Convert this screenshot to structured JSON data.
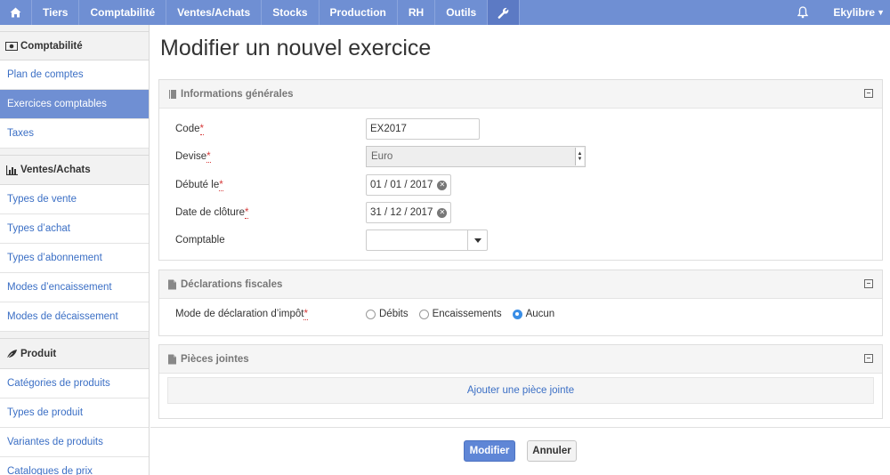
{
  "topnav": {
    "home_icon": "home-icon",
    "items": [
      "Tiers",
      "Comptabilité",
      "Ventes/Achats",
      "Stocks",
      "Production",
      "RH",
      "Outils"
    ],
    "tools_icon": "wrench-icon",
    "bell_icon": "bell-icon",
    "user": "Ekylibre",
    "accent": "#6f8fd3"
  },
  "sidebar": {
    "sections": [
      {
        "title": "Comptabilité",
        "icon": "money-icon",
        "items": [
          "Plan de comptes",
          "Exercices comptables",
          "Taxes"
        ],
        "active": "Exercices comptables"
      },
      {
        "title": "Ventes/Achats",
        "icon": "bar-chart-icon",
        "items": [
          "Types de vente",
          "Types d’achat",
          "Types d’abonnement",
          "Modes d’encaissement",
          "Modes de décaissement"
        ]
      },
      {
        "title": "Produit",
        "icon": "leaf-icon",
        "items": [
          "Catégories de produits",
          "Types de produit",
          "Variantes de produits",
          "Catalogues de prix"
        ]
      }
    ]
  },
  "page": {
    "title": "Modifier un nouvel exercice"
  },
  "general": {
    "title": "Informations générales",
    "code_label": "Code",
    "code_value": "EX2017",
    "currency_label": "Devise",
    "currency_value": "Euro",
    "started_label": "Débuté le",
    "started_value": "01 / 01 / 2017",
    "stopped_label": "Date de clôture",
    "stopped_value": "31 / 12 / 2017",
    "accountant_label": "Comptable",
    "accountant_value": "",
    "required_mark": "*"
  },
  "tax": {
    "title": "Déclarations fiscales",
    "mode_label": "Mode de déclaration d’impôt",
    "options": [
      "Débits",
      "Encaissements",
      "Aucun"
    ],
    "selected": "Aucun"
  },
  "attachments": {
    "title": "Pièces jointes",
    "add_label": "Ajouter une pièce jointe"
  },
  "actions": {
    "submit_label": "Modifier",
    "cancel_label": "Annuler"
  }
}
